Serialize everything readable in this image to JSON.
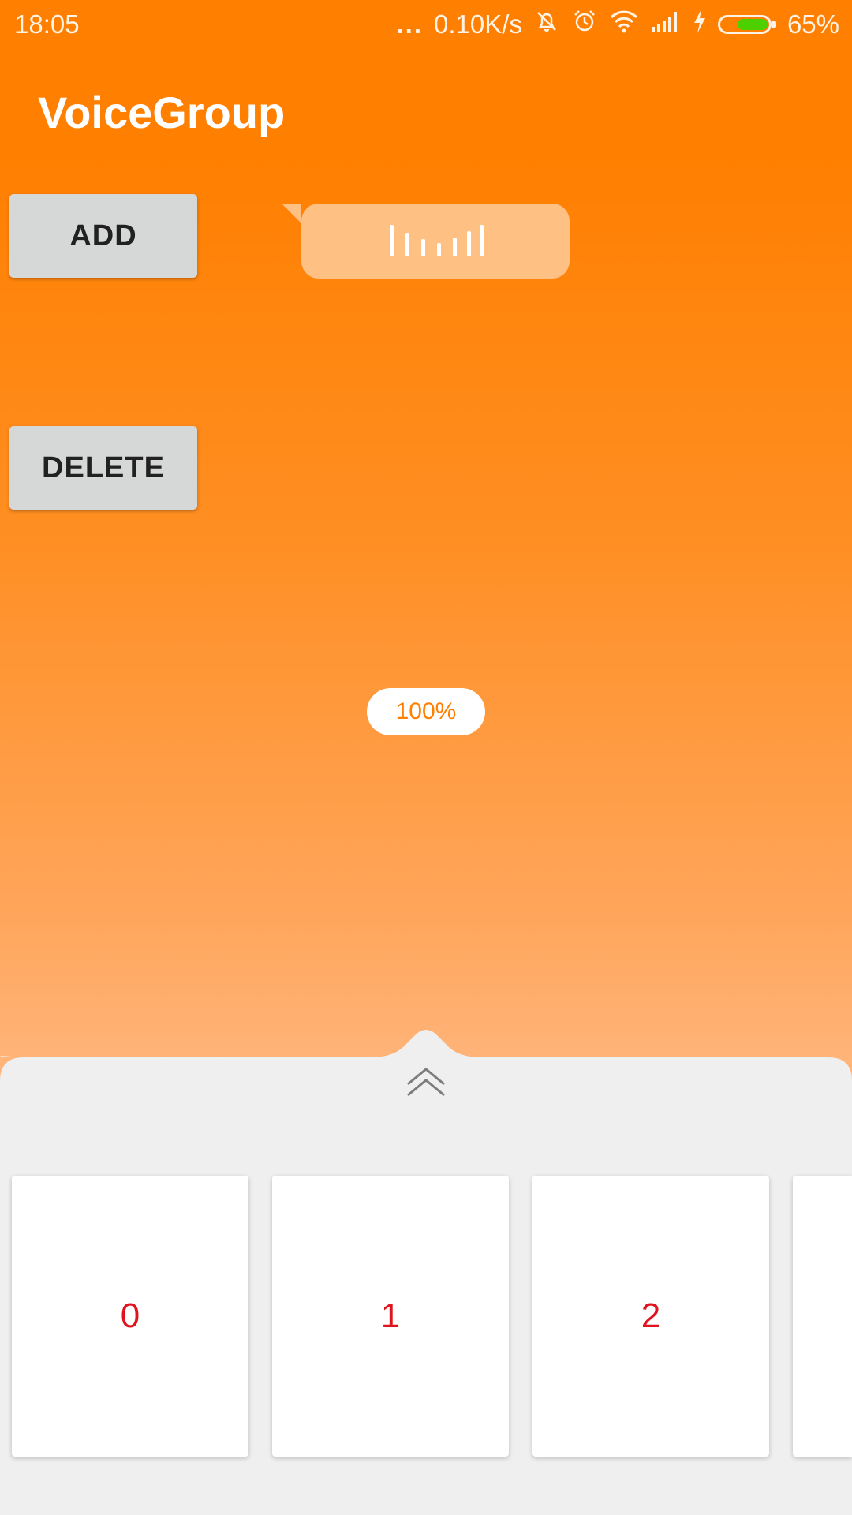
{
  "status_bar": {
    "time": "18:05",
    "dots": "...",
    "net_speed": "0.10K/s",
    "icons": [
      "mute-icon",
      "alarm-icon",
      "wifi-icon",
      "signal-icon",
      "charging-icon",
      "battery-icon"
    ],
    "battery_percent": "65%",
    "battery_level": 0.65,
    "battery_color": "#4cd000"
  },
  "app": {
    "title": "VoiceGroup"
  },
  "buttons": {
    "add_label": "ADD",
    "delete_label": "DELETE"
  },
  "voice_message": {
    "icon": "voice-wave-icon",
    "bubble_color": "#ffc083"
  },
  "progress": {
    "label": "100%",
    "value": 1.0
  },
  "bottom_sheet": {
    "expand_icon": "chevron-up-double-icon",
    "cards": [
      {
        "label": "0"
      },
      {
        "label": "1"
      },
      {
        "label": "2"
      },
      {
        "label": ""
      }
    ]
  },
  "colors": {
    "accent": "#ff7f00",
    "card_text": "#e0141e",
    "sheet": "#efefef"
  }
}
